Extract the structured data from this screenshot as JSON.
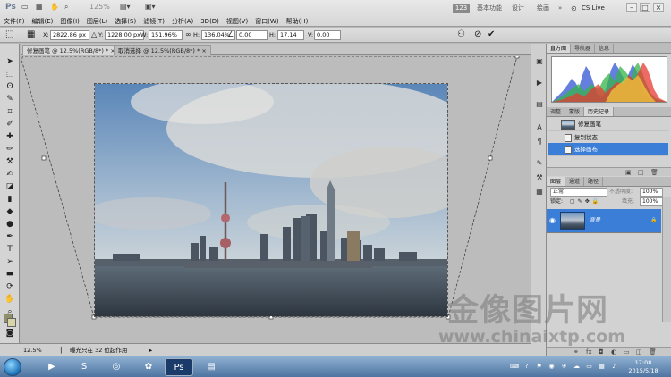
{
  "app": {
    "logo": "Ps",
    "zoom_display": "125%",
    "workspace_badge": "123",
    "workspace_buttons": [
      "基本功能",
      "设计",
      "绘画"
    ],
    "cs_live": "CS Live",
    "chevron": "»"
  },
  "menu": [
    "文件(F)",
    "编辑(E)",
    "图像(I)",
    "图层(L)",
    "选择(S)",
    "滤镜(T)",
    "分析(A)",
    "3D(D)",
    "视图(V)",
    "窗口(W)",
    "帮助(H)"
  ],
  "options": {
    "x_label": "X:",
    "x_value": "2822.86 px",
    "y_label": "Y:",
    "y_value": "1228.00 px",
    "w_label": "W:",
    "w_value": "151.96%",
    "h_label": "H:",
    "h_value": "136.04%",
    "angle_value": "0.00",
    "hskew_label": "H:",
    "hskew_value": "17.14",
    "vskew_label": "V:",
    "vskew_value": "0.00"
  },
  "tabs": [
    {
      "label": "修复画笔 @ 12.5%(RGB/8*) *",
      "close": "×"
    },
    {
      "label": "取消选择 @ 12.5%(RGB/8*) *",
      "close": "×"
    }
  ],
  "status": {
    "zoom": "12.5%",
    "message": "曝光只在 32 位起作用"
  },
  "panels": {
    "top_tabs": [
      "直方图",
      "导航器",
      "信息"
    ],
    "mid_tabs": [
      "调整",
      "蒙版",
      "历史记录"
    ],
    "history": [
      {
        "label": "修复画笔",
        "type": "snapshot"
      },
      {
        "label": "复制状态",
        "type": "state"
      },
      {
        "label": "选择画布",
        "type": "state",
        "selected": true
      }
    ],
    "layer_tabs": [
      "图层",
      "通道",
      "路径"
    ],
    "blend_mode": "正常",
    "opacity_label": "不透明度:",
    "opacity_value": "100%",
    "lock_label": "锁定:",
    "fill_label": "填充:",
    "fill_value": "100%",
    "layer_name": "背景"
  },
  "watermark": {
    "chinese": "金像图片网",
    "url": "www.chinaixtp.com"
  },
  "taskbar": {
    "time": "17:08",
    "date": "2015/5/18",
    "apps": [
      "windows-media-player",
      "sogou",
      "aperture",
      "photoshop",
      "file-explorer"
    ],
    "accent": "#3b7ed8"
  }
}
